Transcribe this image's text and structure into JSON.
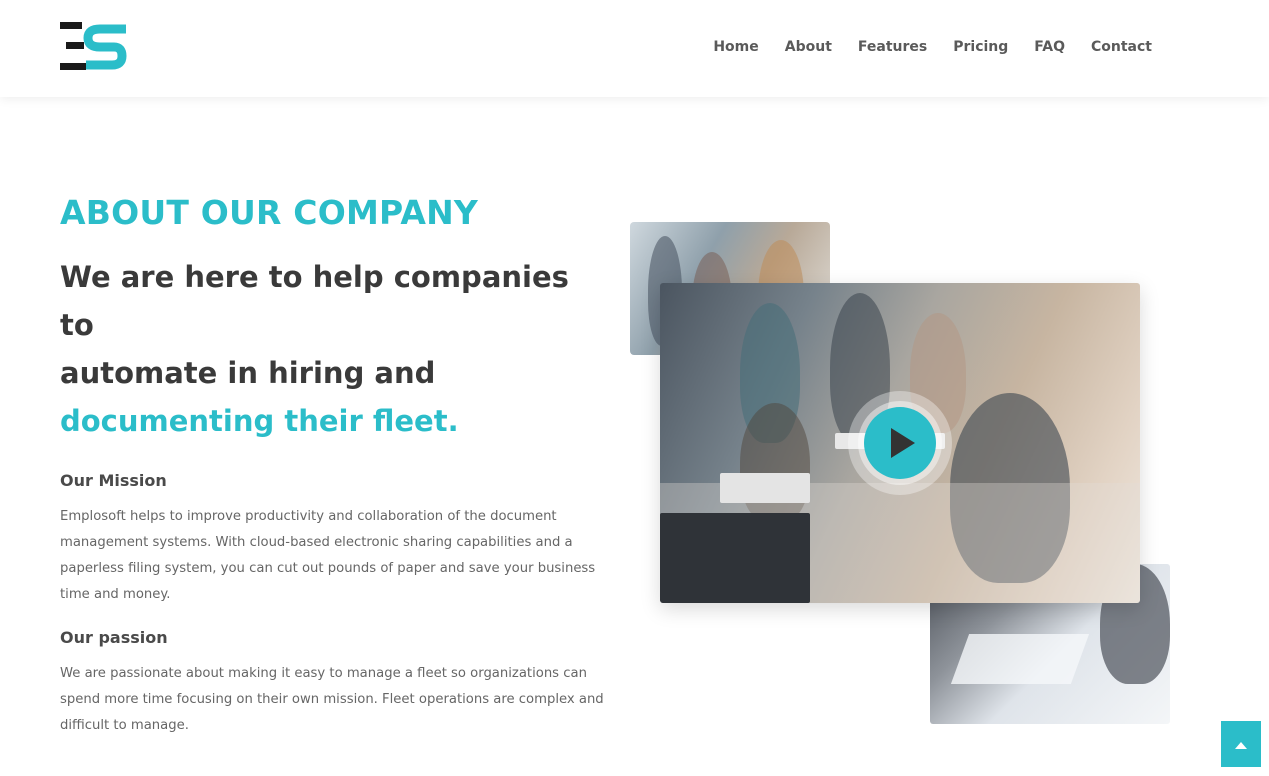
{
  "nav": {
    "items": [
      {
        "label": "Home"
      },
      {
        "label": "About"
      },
      {
        "label": "Features"
      },
      {
        "label": "Pricing"
      },
      {
        "label": "FAQ"
      },
      {
        "label": "Contact"
      }
    ]
  },
  "about": {
    "eyebrow": "ABOUT OUR COMPANY",
    "headline_line1": "We are here to help companies to",
    "headline_line2": "automate in hiring and",
    "headline_accent": "documenting their fleet.",
    "mission_title": "Our Mission",
    "mission_text": "Emplosoft helps to improve productivity and collaboration of the document management systems. With cloud-based electronic sharing capabilities and a paperless filing system, you can cut out pounds of paper and save your business time and money.",
    "passion_title": "Our passion",
    "passion_text": "We are passionate about making it easy to manage a fleet so organizations can spend more time focusing on their own mission. Fleet operations are complex and difficult to manage."
  },
  "icons": {
    "play": "play-icon",
    "back_to_top": "arrow-up-icon"
  },
  "colors": {
    "accent": "#2bbdc9",
    "heading": "#3a3a3a",
    "body_text": "#666666"
  }
}
